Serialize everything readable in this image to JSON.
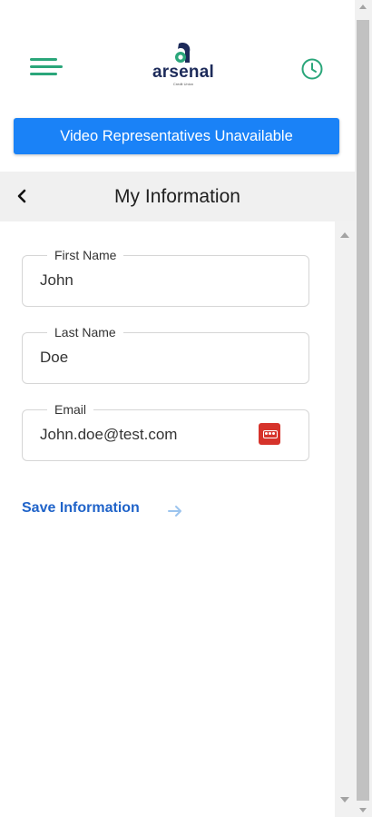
{
  "header": {
    "logo_text": "arsenal",
    "logo_subtext": "Credit Union"
  },
  "banner": {
    "text": "Video Representatives Unavailable"
  },
  "section": {
    "title": "My Information"
  },
  "form": {
    "first_name": {
      "label": "First Name",
      "value": "John"
    },
    "last_name": {
      "label": "Last Name",
      "value": "Doe"
    },
    "email": {
      "label": "Email",
      "value": "John.doe@test.com"
    },
    "save_label": "Save Information"
  },
  "colors": {
    "accent_green": "#2aa67a",
    "banner_blue": "#1a82f7",
    "link_blue": "#1f63c9",
    "logo_navy": "#1d2b5a",
    "badge_red": "#d6332b"
  },
  "icons": {
    "menu": "hamburger-menu-icon",
    "history": "clock-icon",
    "back": "chevron-left-icon",
    "save": "arrow-right-icon",
    "autofill": "password-manager-icon"
  }
}
